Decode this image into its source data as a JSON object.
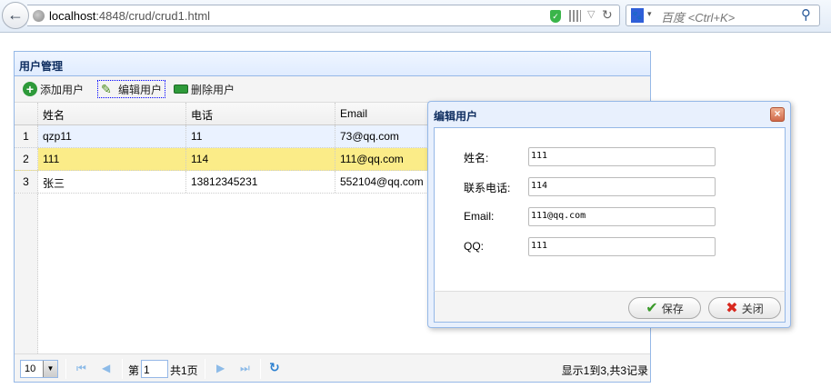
{
  "browser": {
    "url_host": "localhost",
    "url_rest": ":4848/crud/crud1.html",
    "search_placeholder": "百度 <Ctrl+K>"
  },
  "panel": {
    "title": "用户管理",
    "toolbar": {
      "add": "添加用户",
      "edit": "编辑用户",
      "remove": "删除用户"
    },
    "columns": [
      "姓名",
      "电话",
      "Email"
    ],
    "rows": [
      {
        "num": "1",
        "name": "qzp11",
        "phone": "11",
        "email": "73@qq.com"
      },
      {
        "num": "2",
        "name": "111",
        "phone": "114",
        "email": "111@qq.com"
      },
      {
        "num": "3",
        "name": "张三",
        "phone": "13812345231",
        "email": "552104@qq.com"
      }
    ],
    "pager": {
      "page_size": "10",
      "page_prefix": "第",
      "page": "1",
      "page_total": "共1页",
      "summary": "显示1到3,共3记录"
    }
  },
  "dialog": {
    "title": "编辑用户",
    "fields": [
      {
        "label": "姓名:",
        "value": "111"
      },
      {
        "label": "联系电话:",
        "value": "114"
      },
      {
        "label": "Email:",
        "value": "111@qq.com"
      },
      {
        "label": "QQ:",
        "value": "111"
      }
    ],
    "save": "保存",
    "close": "关闭"
  },
  "colors": {
    "selected_row": "#fbec88",
    "hover_row": "#eaf2ff",
    "accent": "#95b8e7"
  }
}
